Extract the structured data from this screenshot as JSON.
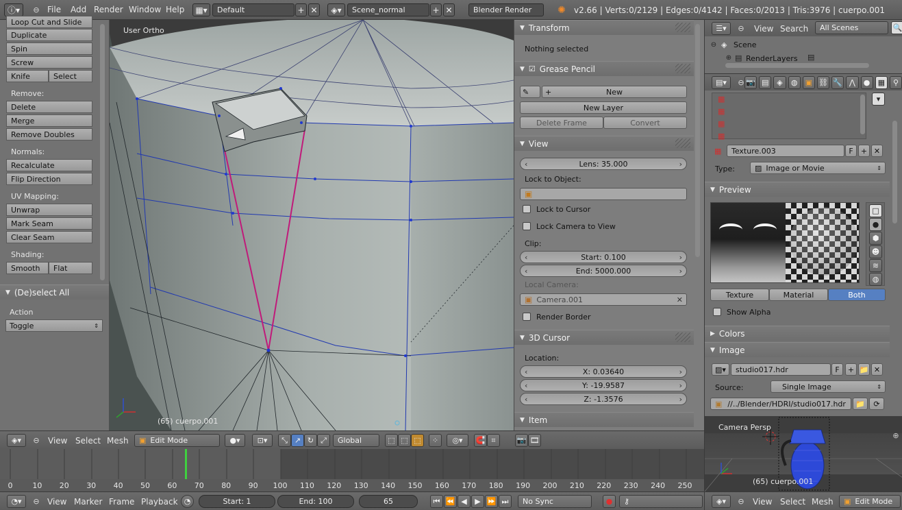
{
  "topbar": {
    "menus": [
      "File",
      "Add",
      "Render",
      "Window",
      "Help"
    ],
    "layout": "Default",
    "scene": "Scene_normal",
    "engine": "Blender Render",
    "stats": "v2.66 | Verts:0/2129 | Edges:0/4142 | Faces:0/2013 | Tris:3976 | cuerpo.001"
  },
  "toolshelf": {
    "loop_cut": "Loop Cut and Slide",
    "duplicate": "Duplicate",
    "spin": "Spin",
    "screw": "Screw",
    "knife": "Knife",
    "select": "Select",
    "remove_label": "Remove:",
    "delete": "Delete",
    "merge": "Merge",
    "remove_doubles": "Remove Doubles",
    "normals_label": "Normals:",
    "recalculate": "Recalculate",
    "flip_direction": "Flip Direction",
    "uv_label": "UV Mapping:",
    "unwrap": "Unwrap",
    "mark_seam": "Mark Seam",
    "clear_seam": "Clear Seam",
    "shading_label": "Shading:",
    "smooth": "Smooth",
    "flat": "Flat",
    "deselect_panel": "(De)select All",
    "action_label": "Action",
    "action_value": "Toggle"
  },
  "viewport": {
    "view_label": "User Ortho",
    "object_label": "(65) cuerpo.001"
  },
  "npanel": {
    "transform": "Transform",
    "nothing_selected": "Nothing selected",
    "grease_pencil": "Grease Pencil",
    "new": "New",
    "new_layer": "New Layer",
    "delete_frame": "Delete Frame",
    "convert": "Convert",
    "view": "View",
    "lens": "Lens: 35.000",
    "lock_to_object": "Lock to Object:",
    "lock_to_cursor": "Lock to Cursor",
    "lock_camera": "Lock Camera to View",
    "clip": "Clip:",
    "clip_start": "Start: 0.100",
    "clip_end": "End: 5000.000",
    "local_camera": "Local Camera:",
    "camera_value": "Camera.001",
    "render_border": "Render Border",
    "cursor_3d": "3D Cursor",
    "location": "Location:",
    "x": "X: 0.03640",
    "y": "Y: -19.9587",
    "z": "Z: -1.3576",
    "item": "Item"
  },
  "outliner": {
    "view": "View",
    "search": "Search",
    "filter": "All Scenes",
    "scene": "Scene",
    "renderlayers": "RenderLayers"
  },
  "props": {
    "texture_name": "Texture.003",
    "f": "F",
    "type_label": "Type:",
    "type_value": "Image or Movie",
    "preview": "Preview",
    "tab_texture": "Texture",
    "tab_material": "Material",
    "tab_both": "Both",
    "show_alpha": "Show Alpha",
    "colors": "Colors",
    "image": "Image",
    "image_name": "studio017.hdr",
    "source_label": "Source:",
    "source_value": "Single Image",
    "path": "//../Blender/HDRI/studio017.hdr"
  },
  "camview": {
    "label": "Camera Persp",
    "object_label": "(65) cuerpo.001"
  },
  "vp_header": {
    "view": "View",
    "select": "Select",
    "mesh": "Mesh",
    "mode": "Edit Mode",
    "orientation": "Global"
  },
  "timeline": {
    "ticks": [
      "0",
      "10",
      "20",
      "30",
      "40",
      "50",
      "60",
      "70",
      "80",
      "90",
      "100",
      "110",
      "120",
      "130",
      "140",
      "150",
      "160",
      "170",
      "180",
      "190",
      "200",
      "210",
      "220",
      "230",
      "240",
      "250"
    ],
    "current_frame": 65
  },
  "tl_header": {
    "view": "View",
    "marker": "Marker",
    "frame": "Frame",
    "playback": "Playback",
    "start": "Start: 1",
    "end": "End: 100",
    "current": "65",
    "sync": "No Sync"
  },
  "cam_header": {
    "view": "View",
    "select": "Select",
    "mesh": "Mesh",
    "mode": "Edit Mode"
  }
}
